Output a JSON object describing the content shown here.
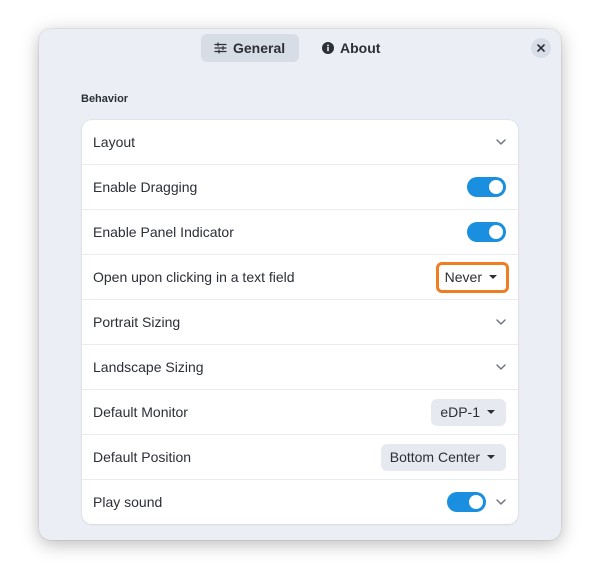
{
  "tabs": [
    {
      "label": "General",
      "icon": "sliders-icon",
      "selected": true
    },
    {
      "label": "About",
      "icon": "info-icon",
      "selected": false
    }
  ],
  "close_icon": "close-icon",
  "section": {
    "title": "Behavior"
  },
  "rows": [
    {
      "label": "Layout",
      "control": "chevron"
    },
    {
      "label": "Enable Dragging",
      "control": "switch",
      "on": true
    },
    {
      "label": "Enable Panel Indicator",
      "control": "switch",
      "on": true
    },
    {
      "label": "Open upon clicking in a text field",
      "control": "dropdown",
      "value": "Never",
      "highlighted": true
    },
    {
      "label": "Portrait Sizing",
      "control": "chevron"
    },
    {
      "label": "Landscape Sizing",
      "control": "chevron"
    },
    {
      "label": "Default Monitor",
      "control": "dropdown",
      "value": "eDP-1"
    },
    {
      "label": "Default Position",
      "control": "dropdown",
      "value": "Bottom Center"
    },
    {
      "label": "Play sound",
      "control": "switch-chevron",
      "on": true
    }
  ],
  "colors": {
    "accent": "#1a8fe0",
    "highlight_border": "#ef7d22",
    "window_bg": "#ebeff5",
    "text": "#2b2f36"
  }
}
